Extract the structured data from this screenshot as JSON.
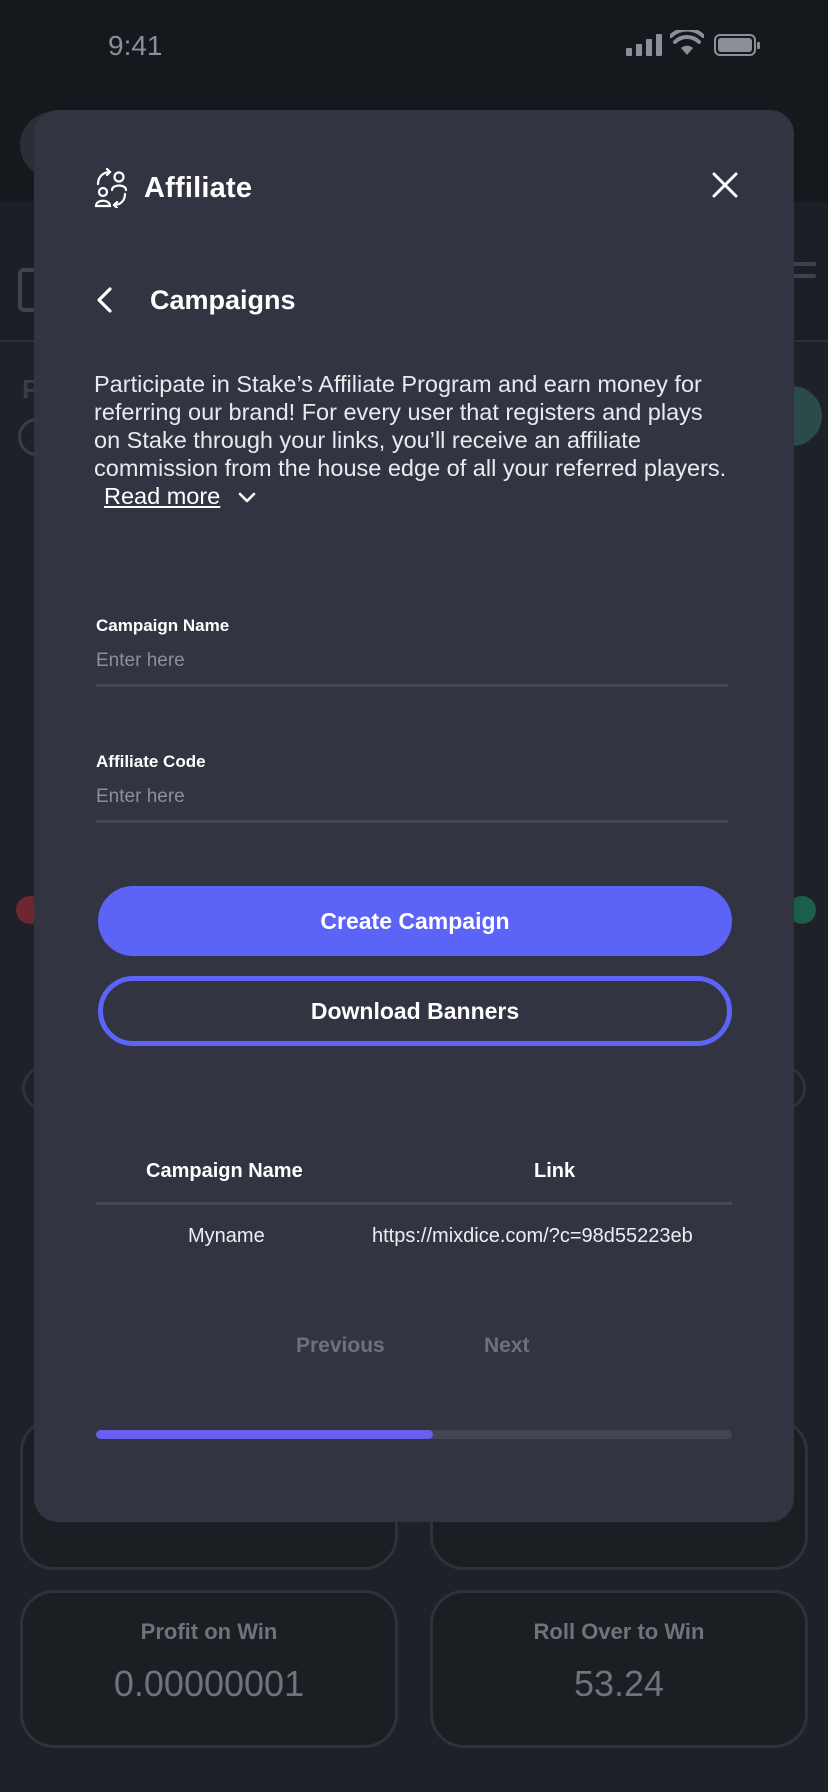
{
  "status_bar": {
    "time": "9:41"
  },
  "background": {
    "letter": "P",
    "cards": [
      {
        "label": "Profit on Win",
        "value": "0.00000001"
      },
      {
        "label": "Roll Over to Win",
        "value": "53.24"
      }
    ]
  },
  "modal": {
    "title": "Affiliate",
    "icon": "affiliate-icon",
    "subtitle": "Campaigns",
    "description": "Participate in Stake’s Affiliate Program and earn money for referring our brand! For every user that registers and plays on Stake through your links, you’ll receive an affiliate commission from the house edge of all your referred players.",
    "read_more": "Read more",
    "fields": {
      "campaign_name": {
        "label": "Campaign Name",
        "placeholder": "Enter here",
        "value": ""
      },
      "affiliate_code": {
        "label": "Affiliate Code",
        "placeholder": "Enter here",
        "value": ""
      }
    },
    "buttons": {
      "create": "Create Campaign",
      "download": "Download Banners"
    },
    "table": {
      "columns": [
        "Campaign Name",
        "Link"
      ],
      "rows": [
        {
          "name": "Myname",
          "link": "https://mixdice.com/?c=98d55223eb"
        }
      ]
    },
    "pagination": {
      "previous": "Previous",
      "next": "Next"
    },
    "progress": 0.53
  },
  "colors": {
    "accent": "#5c63f7",
    "modal_bg": "#323541",
    "progress": "#6a5ef0"
  }
}
